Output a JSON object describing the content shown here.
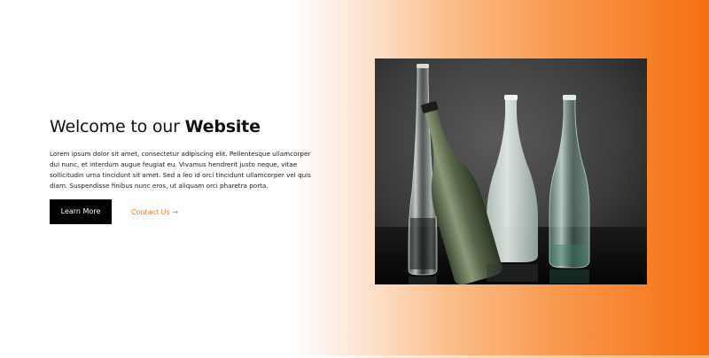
{
  "hero": {
    "title_lead": "Welcome to our ",
    "title_emphasis": "Website",
    "body": "Lorem ipsum dolor sit amet, consectetur adipiscing elit. Pellentesque ullamcorper dui nunc, et interdum augue feugiat eu. Vivamus hendrerit justo neque, vitae sollicitudin urna tincidunt sit amet. Sed a leo id orci tincidunt ullamcorper vel quis diam. Suspendisse finibus nunc eros, ut aliquam orci pharetra porta.",
    "primary_button": "Learn More",
    "secondary_link": "Contact Us",
    "secondary_link_icon": "arrow-right-icon"
  },
  "image": {
    "subject": "glass-bottles-photo"
  },
  "colors": {
    "accent": "#f57010",
    "link": "#f07a1e",
    "button_bg": "#000000",
    "button_text": "#ffffff",
    "heading": "#111111"
  }
}
